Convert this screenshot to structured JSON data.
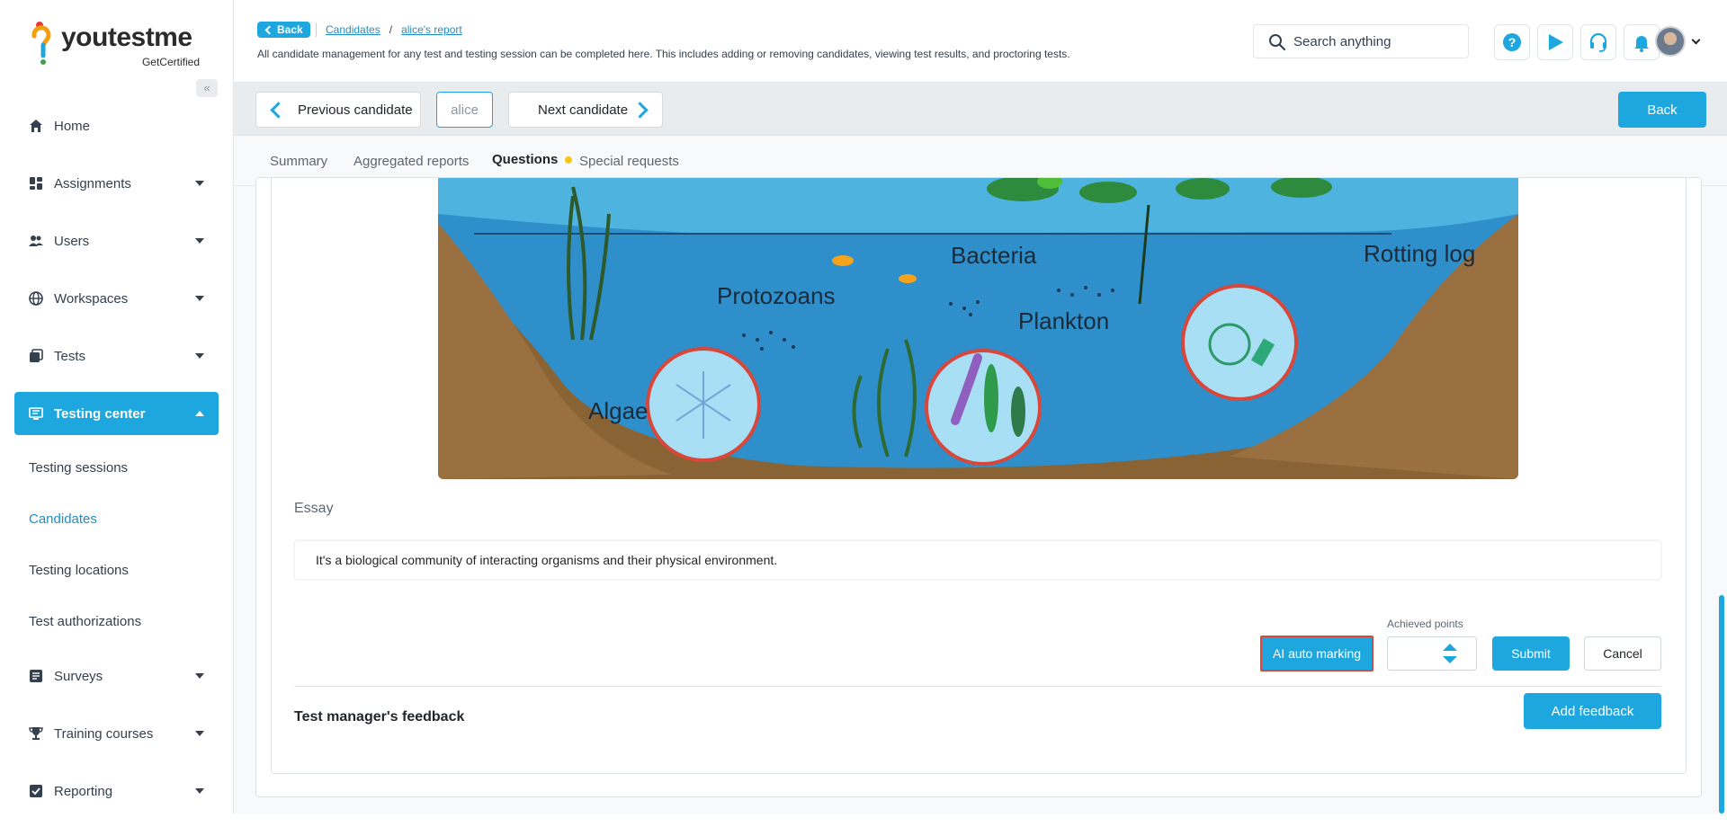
{
  "brand": {
    "name": "youtestme",
    "tagline": "GetCertified",
    "colors": {
      "accent": "#1ea7df",
      "highlight": "#d9463a",
      "dot": "#f5c518"
    }
  },
  "sidebar": {
    "items": [
      {
        "label": "Home",
        "icon": "home-icon"
      },
      {
        "label": "Assignments",
        "icon": "assignments-icon"
      },
      {
        "label": "Users",
        "icon": "users-icon"
      },
      {
        "label": "Workspaces",
        "icon": "globe-icon"
      },
      {
        "label": "Tests",
        "icon": "tests-icon"
      },
      {
        "label": "Testing center",
        "icon": "monitor-icon",
        "expanded": true
      },
      {
        "label": "Surveys",
        "icon": "survey-icon"
      },
      {
        "label": "Training courses",
        "icon": "trophy-icon"
      },
      {
        "label": "Reporting",
        "icon": "reporting-icon"
      }
    ],
    "sub_items": [
      {
        "label": "Testing sessions"
      },
      {
        "label": "Candidates",
        "current": true
      },
      {
        "label": "Testing locations"
      },
      {
        "label": "Test authorizations"
      }
    ]
  },
  "header": {
    "back_label": "Back",
    "breadcrumbs": [
      "Candidates",
      "/",
      "alice's report"
    ],
    "description": "All candidate management for any test and testing session can be completed here. This includes adding or removing candidates, viewing test results, and proctoring tests.",
    "search_placeholder": "Search anything",
    "tool_icons": [
      "help-icon",
      "play-icon",
      "headset-icon",
      "bell-icon"
    ]
  },
  "candidate_bar": {
    "previous_label": "Previous candidate",
    "name": "alice",
    "next_label": "Next candidate",
    "back_label": "Back"
  },
  "tabs": [
    {
      "label": "Summary"
    },
    {
      "label": "Aggregated reports"
    },
    {
      "label": "Questions",
      "active": true,
      "has_dot": true
    },
    {
      "label": "Special requests"
    }
  ],
  "question": {
    "image": {
      "labels": [
        "Protozoans",
        "Bacteria",
        "Plankton",
        "Rotting log",
        "Algae"
      ]
    },
    "section_label": "Essay",
    "answer": "It's a biological community of interacting organisms and their physical environment.",
    "points_label": "Achieved points",
    "points_value": "",
    "ai_button": "AI auto marking",
    "submit_label": "Submit",
    "cancel_label": "Cancel",
    "feedback_title": "Test manager's feedback",
    "add_feedback_label": "Add feedback"
  }
}
